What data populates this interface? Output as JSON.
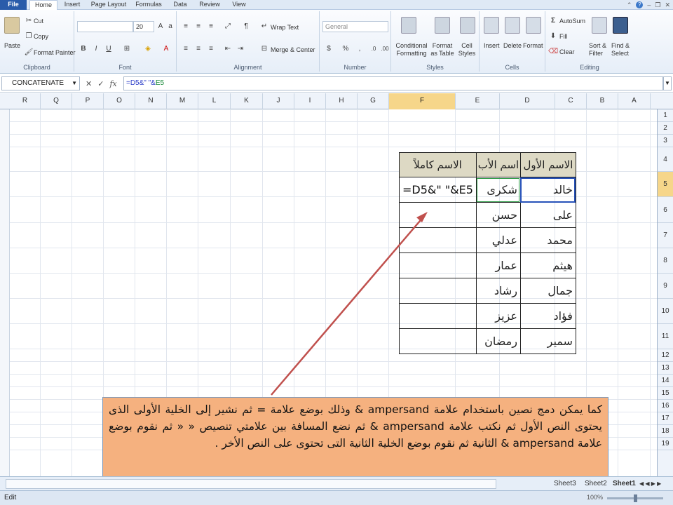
{
  "tabs": [
    "File",
    "Home",
    "Insert",
    "Page Layout",
    "Formulas",
    "Data",
    "Review",
    "View"
  ],
  "clipboard": {
    "paste": "Paste",
    "cut": "Cut",
    "copy": "Copy",
    "format_painter": "Format Painter",
    "label": "Clipboard"
  },
  "font": {
    "size": "20",
    "label": "Font"
  },
  "alignment": {
    "wrap": "Wrap Text",
    "merge": "Merge & Center",
    "label": "Alignment"
  },
  "number": {
    "format": "General",
    "label": "Number"
  },
  "styles": {
    "cond": "Conditional Formatting",
    "astable": "Format as Table",
    "cellstyles": "Cell Styles",
    "label": "Styles"
  },
  "cells": {
    "insert": "Insert",
    "delete": "Delete",
    "format": "Format",
    "label": "Cells"
  },
  "editing": {
    "autosum": "AutoSum",
    "fill": "Fill",
    "clear": "Clear",
    "sort": "Sort & Filter",
    "find": "Find & Select",
    "label": "Editing"
  },
  "formula_bar": {
    "name_box": "CONCATENATE",
    "formula_prefix": "=D5&\" \"&",
    "formula_ref": "E5"
  },
  "columns": [
    "R",
    "Q",
    "P",
    "O",
    "N",
    "M",
    "L",
    "K",
    "J",
    "I",
    "H",
    "G",
    "F",
    "E",
    "D",
    "C",
    "B",
    "A"
  ],
  "selected_column": "F",
  "rows": [
    "1",
    "2",
    "3",
    "4",
    "5",
    "6",
    "7",
    "8",
    "9",
    "10",
    "11",
    "12",
    "13",
    "14",
    "15",
    "16",
    "17",
    "18",
    "19"
  ],
  "selected_row": "5",
  "table": {
    "headers": [
      "الاسم الأول",
      "اسم الأب",
      "الاسم كاملاً"
    ],
    "rows": [
      [
        "خالد",
        "شكرى",
        "=D5&\" \"&E5"
      ],
      [
        "على",
        "حسن",
        ""
      ],
      [
        "محمد",
        "عدلي",
        ""
      ],
      [
        "هيثم",
        "عمار",
        ""
      ],
      [
        "جمال",
        "رشاد",
        ""
      ],
      [
        "فؤاد",
        "عزيز",
        ""
      ],
      [
        "سمير",
        "رمضان",
        ""
      ]
    ]
  },
  "note": "كما يمكن دمج نصين باستخدام علامة ampersand & وذلك بوضع علامة = ثم نشير إلى الخلية الأولى الذى يحتوى النص الأول ثم نكتب علامة ampersand & ثم نضع المسافة بين علامتي تنصيص « « ثم نقوم بوضع علامة ampersand & الثانية ثم نقوم بوضع الخلية الثانية التى تحتوى على النص الأخر .",
  "sheets": [
    "Sheet3",
    "Sheet2",
    "Sheet1"
  ],
  "status": {
    "mode": "Edit",
    "zoom": "100%"
  }
}
